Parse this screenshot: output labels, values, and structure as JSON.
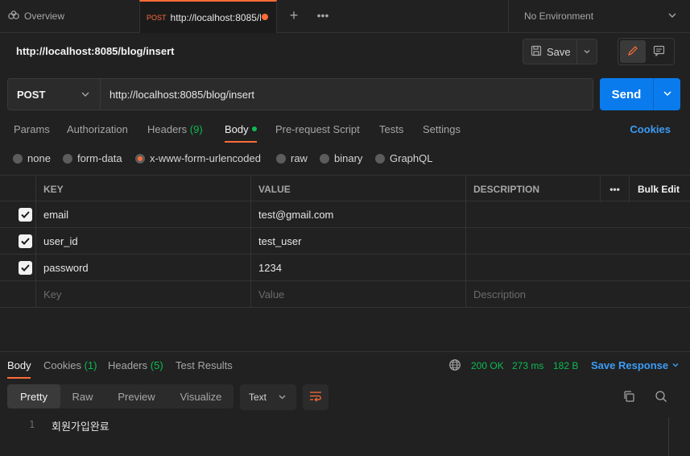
{
  "tabs": {
    "overview_label": "Overview",
    "request_method": "POST",
    "request_title": "http://localhost:8085/blog/insert",
    "plus": "+",
    "more": "•••"
  },
  "environment": {
    "label": "No Environment"
  },
  "header": {
    "title": "http://localhost:8085/blog/insert",
    "save_label": "Save"
  },
  "request": {
    "method": "POST",
    "url": "http://localhost:8085/blog/insert",
    "send_label": "Send"
  },
  "request_tabs": {
    "params": "Params",
    "authorization": "Authorization",
    "headers": "Headers",
    "headers_count": "(9)",
    "body": "Body",
    "pre_request": "Pre-request Script",
    "tests": "Tests",
    "settings": "Settings",
    "cookies": "Cookies"
  },
  "body_types": {
    "none": "none",
    "form_data": "form-data",
    "urlencoded": "x-www-form-urlencoded",
    "raw": "raw",
    "binary": "binary",
    "graphql": "GraphQL",
    "selected": "x-www-form-urlencoded"
  },
  "params_table": {
    "headers": {
      "key": "KEY",
      "value": "VALUE",
      "description": "DESCRIPTION",
      "more": "•••",
      "bulk_edit": "Bulk Edit"
    },
    "rows": [
      {
        "key": "email",
        "value": "test@gmail.com",
        "description": "",
        "checked": true
      },
      {
        "key": "user_id",
        "value": "test_user",
        "description": "",
        "checked": true
      },
      {
        "key": "password",
        "value": "1234",
        "description": "",
        "checked": true
      }
    ],
    "placeholders": {
      "key": "Key",
      "value": "Value",
      "description": "Description"
    }
  },
  "response": {
    "tabs": {
      "body": "Body",
      "cookies": "Cookies",
      "cookies_count": "(1)",
      "headers": "Headers",
      "headers_count": "(5)",
      "test_results": "Test Results"
    },
    "status": "200 OK",
    "time": "273 ms",
    "size": "182 B",
    "save_response": "Save Response",
    "formats": {
      "pretty": "Pretty",
      "raw": "Raw",
      "preview": "Preview",
      "visualize": "Visualize"
    },
    "language": "Text",
    "line_number": "1",
    "body_text": "회원가입완료"
  },
  "colors": {
    "accent": "#ff6c37",
    "send": "#097bed",
    "success": "#0cbb52",
    "link": "#3d9cf5"
  }
}
